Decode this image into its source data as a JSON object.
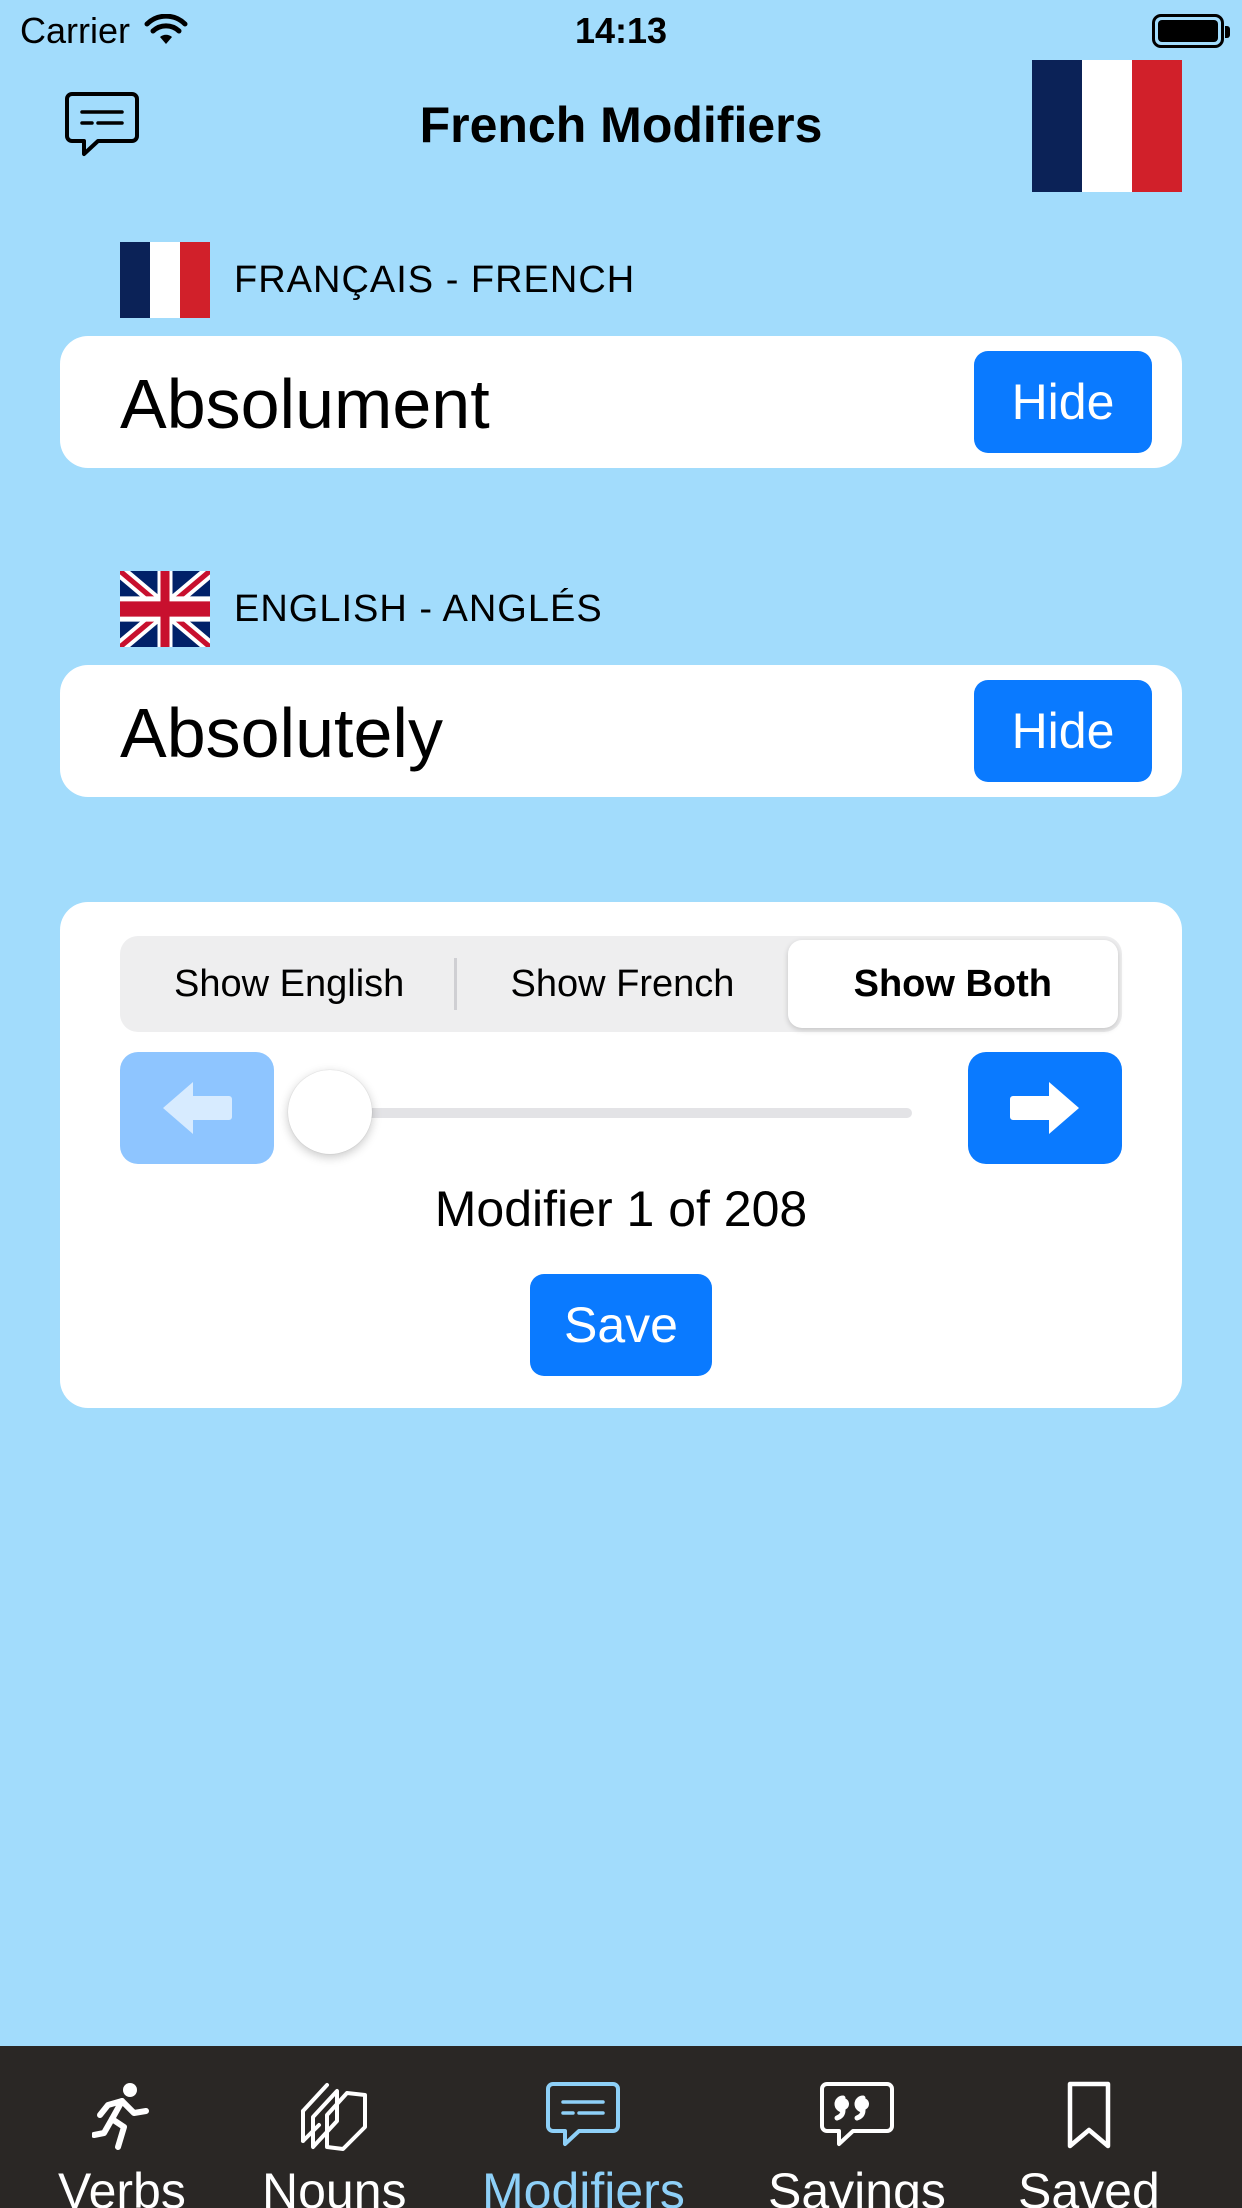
{
  "status_bar": {
    "carrier": "Carrier",
    "time": "14:13"
  },
  "header": {
    "title": "French Modifiers"
  },
  "french_section": {
    "label": "FRANÇAIS - FRENCH",
    "word": "Absolument",
    "hide_label": "Hide"
  },
  "english_section": {
    "label": "ENGLISH - ANGLÉS",
    "word": "Absolutely",
    "hide_label": "Hide"
  },
  "controls": {
    "segments": [
      "Show English",
      "Show French",
      "Show Both"
    ],
    "selected_segment": "Show Both",
    "slider": {
      "value": 1,
      "min": 1,
      "max": 208
    },
    "counter_text": "Modifier 1 of 208",
    "save_label": "Save"
  },
  "tab_bar": {
    "tabs": [
      {
        "label": "Verbs",
        "icon": "running-person-icon"
      },
      {
        "label": "Nouns",
        "icon": "stacked-cards-icon"
      },
      {
        "label": "Modifiers",
        "icon": "message-lines-icon"
      },
      {
        "label": "Sayings",
        "icon": "quote-bubble-icon"
      },
      {
        "label": "Saved",
        "icon": "bookmark-icon"
      }
    ],
    "active": "Modifiers"
  },
  "colors": {
    "background": "#a2dcfc",
    "accent": "#0a7aff",
    "accent_disabled": "#8ec5ff",
    "tab_bar": "#2a2725",
    "tab_active": "#8ed0f8"
  }
}
